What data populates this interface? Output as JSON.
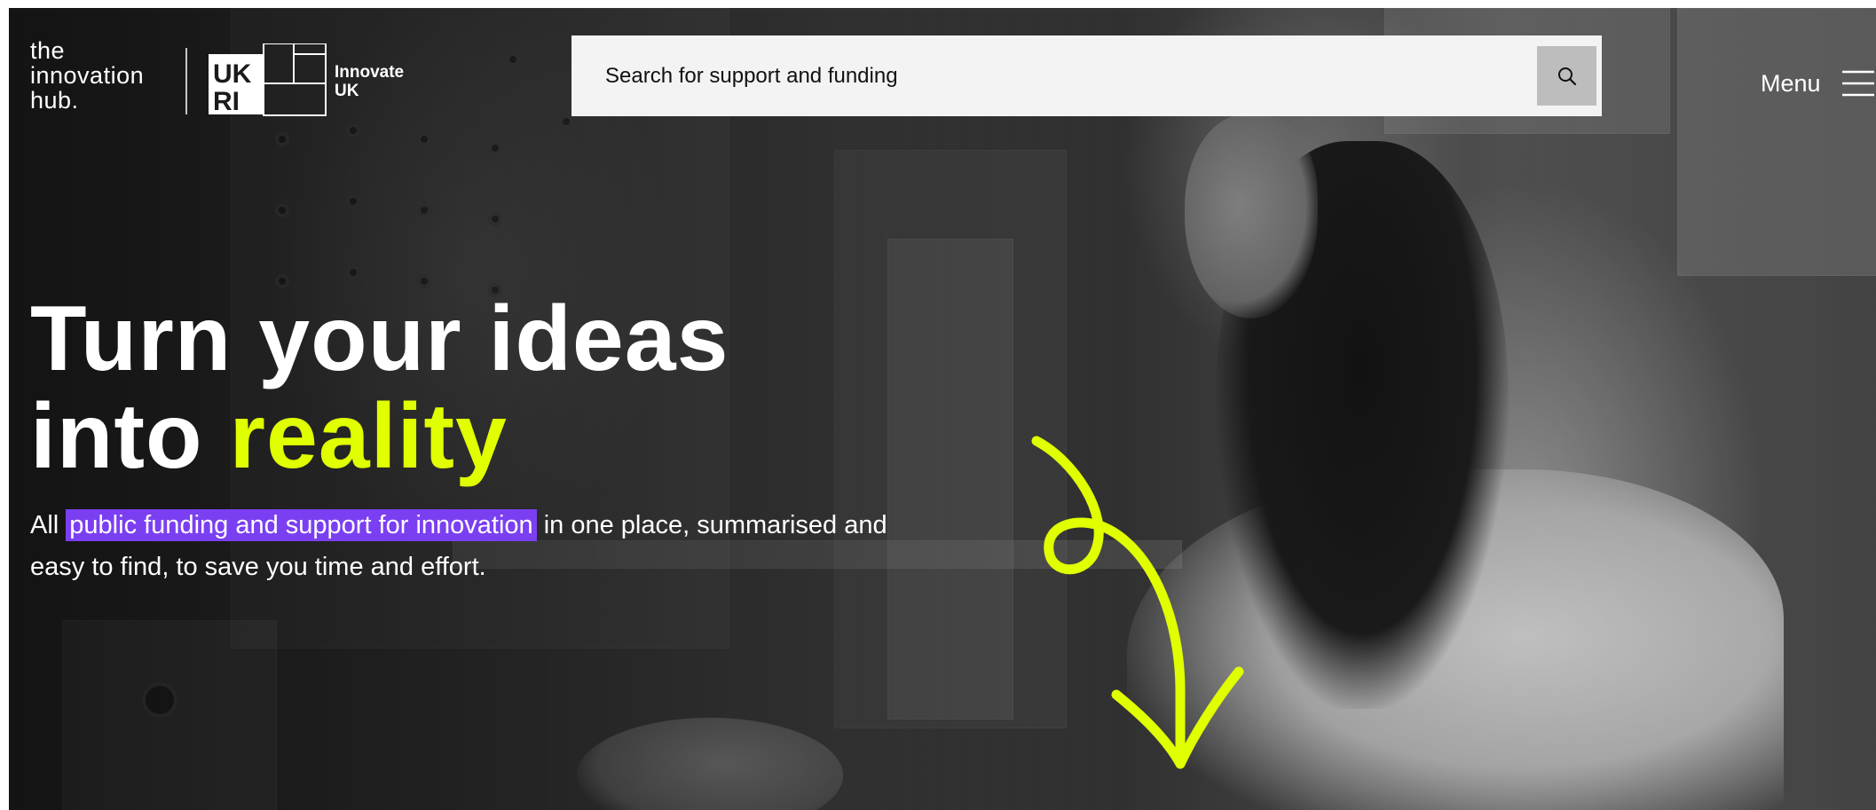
{
  "colors": {
    "accent_yellow": "#e0ff00",
    "highlight_purple": "#7b3ff2",
    "search_bg": "#f3f3f3",
    "search_button_bg": "#bdbdbd"
  },
  "header": {
    "logo_wordmark": [
      "the",
      "innovation",
      "hub."
    ],
    "partner_logo": {
      "ukri_mark": "UKRI",
      "innovate_uk": [
        "Innovate",
        "UK"
      ]
    },
    "search": {
      "placeholder": "Search for support and funding",
      "button_icon": "search-icon"
    },
    "menu": {
      "label": "Menu",
      "icon": "hamburger-icon"
    }
  },
  "hero": {
    "title_line1": "Turn your ideas",
    "title_line2_plain": "into ",
    "title_line2_accent": "reality",
    "description": {
      "prefix": "All ",
      "highlight": "public funding and support for innovation",
      "suffix": " in one place, summarised and",
      "line2": "easy to find, to save you time and effort."
    },
    "arrow_icon": "curly-arrow-down-icon"
  }
}
